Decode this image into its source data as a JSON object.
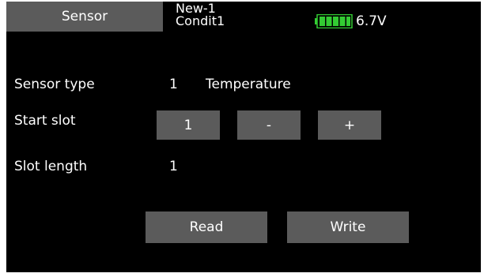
{
  "header": {
    "screen_title": "Sensor",
    "model_name": "New-1",
    "condition": "Condit1",
    "battery_voltage": "6.7V",
    "battery_icon": "battery-full-icon",
    "battery_color": "#33cc33"
  },
  "sensor_type": {
    "label": "Sensor type",
    "number": "1",
    "name": "Temperature"
  },
  "start_slot": {
    "label": "Start slot",
    "value": "1",
    "decrement_label": "-",
    "increment_label": "+"
  },
  "slot_length": {
    "label": "Slot length",
    "value": "1"
  },
  "actions": {
    "read_label": "Read",
    "write_label": "Write"
  },
  "colors": {
    "background": "#000000",
    "button": "#5b5b5b",
    "text": "#ffffff"
  }
}
